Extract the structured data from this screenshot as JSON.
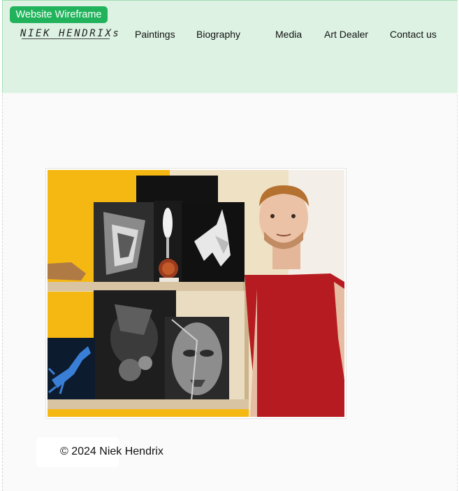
{
  "badge": {
    "label": "Website Wireframe",
    "color": "#21b35b"
  },
  "header": {
    "logo": "NIEK HENDRIXs",
    "background": "#ddf2e3",
    "nav": [
      {
        "label": "Paintings"
      },
      {
        "label": "Biography"
      },
      {
        "label": "Media"
      },
      {
        "label": "Art Dealer"
      },
      {
        "label": "Contact us"
      }
    ]
  },
  "hero": {
    "image": "photo of the artist in a red t-shirt standing beside a shelf of black-and-white paintings"
  },
  "footer": {
    "copyright": "© 2024 Niek Hendrix"
  }
}
